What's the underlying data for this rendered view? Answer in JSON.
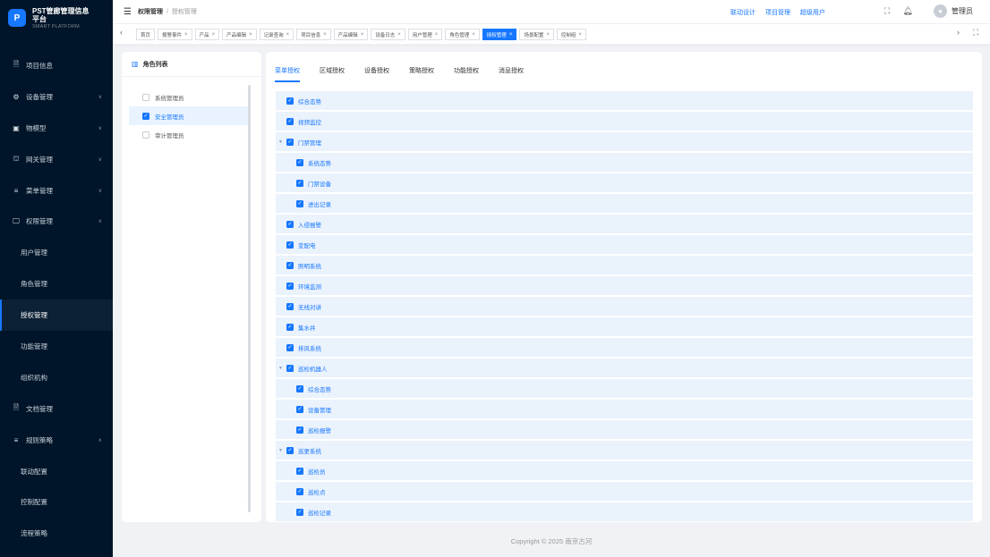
{
  "app": {
    "title_line1": "PST管廊管理信息",
    "title_line2": "平台",
    "subtitle": "SMART PLATFORM",
    "logo_letter": "P"
  },
  "sidebar": {
    "items": [
      {
        "label": "项目信息",
        "icon": "document-icon",
        "chevron": ""
      },
      {
        "label": "设备管理",
        "icon": "gear-icon",
        "chevron": "∨"
      },
      {
        "label": "物模型",
        "icon": "cube-icon",
        "chevron": "∨"
      },
      {
        "label": "网关管理",
        "icon": "network-icon",
        "chevron": "∨"
      },
      {
        "label": "菜单管理",
        "icon": "menu-icon",
        "chevron": "∨"
      },
      {
        "label": "权限管理",
        "icon": "monitor-icon",
        "chevron": "∧"
      },
      {
        "label": "用户管理",
        "sub": true
      },
      {
        "label": "角色管理",
        "sub": true
      },
      {
        "label": "授权管理",
        "sub": true,
        "active": true
      },
      {
        "label": "功能管理",
        "sub": true
      },
      {
        "label": "组织机构",
        "sub": true
      },
      {
        "label": "文档管理",
        "icon": "document-icon",
        "chevron": ""
      },
      {
        "label": "规则策略",
        "icon": "menu-icon",
        "chevron": "∧"
      },
      {
        "label": "联动配置",
        "sub": true
      },
      {
        "label": "控制配置",
        "sub": true
      },
      {
        "label": "流程策略",
        "sub": true
      }
    ]
  },
  "header": {
    "breadcrumb_parent": "权限管理",
    "breadcrumb_sep": "/",
    "breadcrumb_current": "授权管理",
    "links": [
      "联动设计",
      "项目管理",
      "超级用户"
    ],
    "username": "管理员"
  },
  "tabs": [
    {
      "label": "首页",
      "closable": false
    },
    {
      "label": "报警事件",
      "closable": true
    },
    {
      "label": "产品",
      "closable": true
    },
    {
      "label": "产品编辑",
      "closable": true
    },
    {
      "label": "记录查询",
      "closable": true
    },
    {
      "label": "项目信息",
      "closable": true
    },
    {
      "label": "产品编辑",
      "closable": true
    },
    {
      "label": "设备日志",
      "closable": true
    },
    {
      "label": "用户管理",
      "closable": true
    },
    {
      "label": "角色管理",
      "closable": true
    },
    {
      "label": "授权管理",
      "closable": true,
      "active": true
    },
    {
      "label": "场景配置",
      "closable": true
    },
    {
      "label": "控制组",
      "closable": true
    }
  ],
  "role_panel": {
    "title": "角色列表",
    "roles": [
      {
        "label": "系统管理员",
        "checked": false
      },
      {
        "label": "安全管理员",
        "checked": true
      },
      {
        "label": "审计管理员",
        "checked": false
      }
    ]
  },
  "auth_tabs": [
    "菜单授权",
    "区域授权",
    "设备授权",
    "策略授权",
    "功能授权",
    "消息授权"
  ],
  "menu_tree": [
    {
      "label": "综合态势",
      "level": 1
    },
    {
      "label": "视频监控",
      "level": 1
    },
    {
      "label": "门禁管理",
      "level": 1,
      "expanded": true
    },
    {
      "label": "系统态势",
      "level": 2
    },
    {
      "label": "门禁设备",
      "level": 2
    },
    {
      "label": "进出记录",
      "level": 2
    },
    {
      "label": "入侵报警",
      "level": 1
    },
    {
      "label": "变配电",
      "level": 1
    },
    {
      "label": "照明系统",
      "level": 1
    },
    {
      "label": "环境监测",
      "level": 1
    },
    {
      "label": "无线对讲",
      "level": 1
    },
    {
      "label": "集水井",
      "level": 1
    },
    {
      "label": "排风系统",
      "level": 1
    },
    {
      "label": "巡检机器人",
      "level": 1,
      "expanded": true
    },
    {
      "label": "综合态势",
      "level": 2
    },
    {
      "label": "设备管理",
      "level": 2
    },
    {
      "label": "巡检报警",
      "level": 2
    },
    {
      "label": "巡更系统",
      "level": 1,
      "expanded": true
    },
    {
      "label": "巡检员",
      "level": 2
    },
    {
      "label": "巡检点",
      "level": 2
    },
    {
      "label": "巡检记录",
      "level": 2
    }
  ],
  "footer": "Copyright © 2025 南京古河",
  "colors": {
    "sidebar_bg": "#001529",
    "accent": "#1677ff",
    "row_bg": "#eaf2fc"
  }
}
